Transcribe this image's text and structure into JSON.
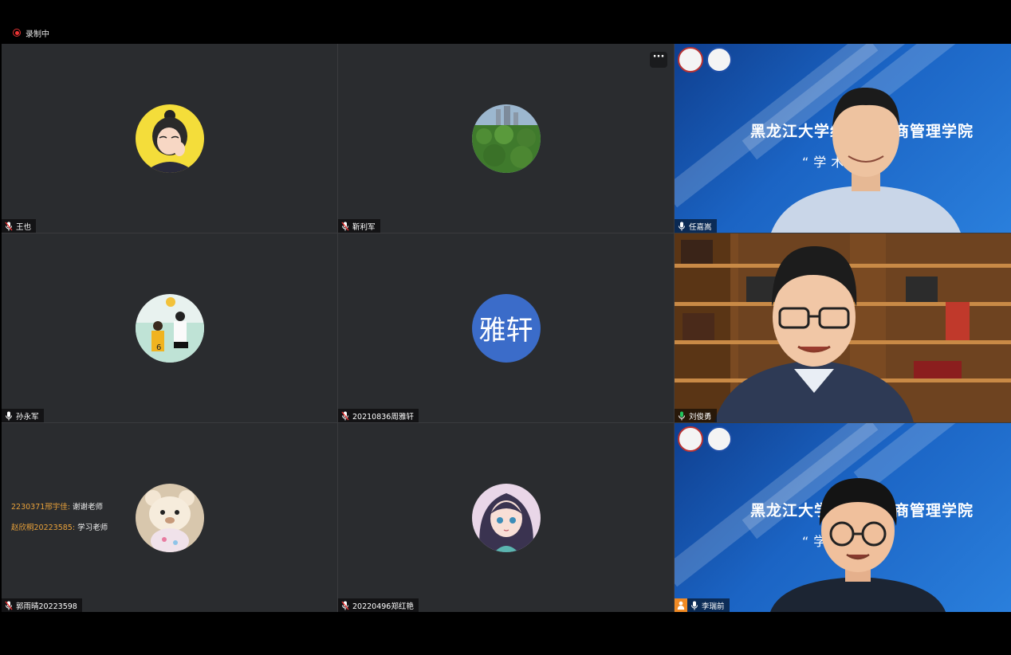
{
  "recording": {
    "label": "录制中"
  },
  "tiles": [
    {
      "name": "王也",
      "mic": "muted",
      "avatar": "cartoon-girl"
    },
    {
      "name": "靳利军",
      "mic": "muted",
      "avatar": "forest-photo"
    },
    {
      "name": "任嘉嵩",
      "mic": "on",
      "video": true
    },
    {
      "name": "孙永军",
      "mic": "on",
      "avatar": "volleyball-anime"
    },
    {
      "name": "20210836周雅轩",
      "mic": "muted",
      "avatar_text": "雅轩"
    },
    {
      "name": "刘俊勇",
      "mic": "speaking",
      "video": true
    },
    {
      "name": "郭雨晴20223598",
      "mic": "muted",
      "avatar": "teddy-bear"
    },
    {
      "name": "20220496郑红艳",
      "mic": "muted",
      "avatar": "anime-girl"
    },
    {
      "name": "李瑞前",
      "mic": "on",
      "video": true,
      "host": true
    }
  ],
  "banner": {
    "title": "黑龙江大学经济与工商管理学院",
    "subtitle": "“学术讲座"
  },
  "chat": [
    {
      "sender": "2230371邢宇佳:",
      "text": "谢谢老师"
    },
    {
      "sender": "赵欣桐20223585:",
      "text": "学习老师"
    }
  ],
  "more_button": {
    "label": "···"
  },
  "colors": {
    "speaking_border": "#22c55e",
    "chat_sender": "#e8a13a",
    "host_badge": "#f08a24",
    "avatar_blue": "#3b6cc9"
  }
}
